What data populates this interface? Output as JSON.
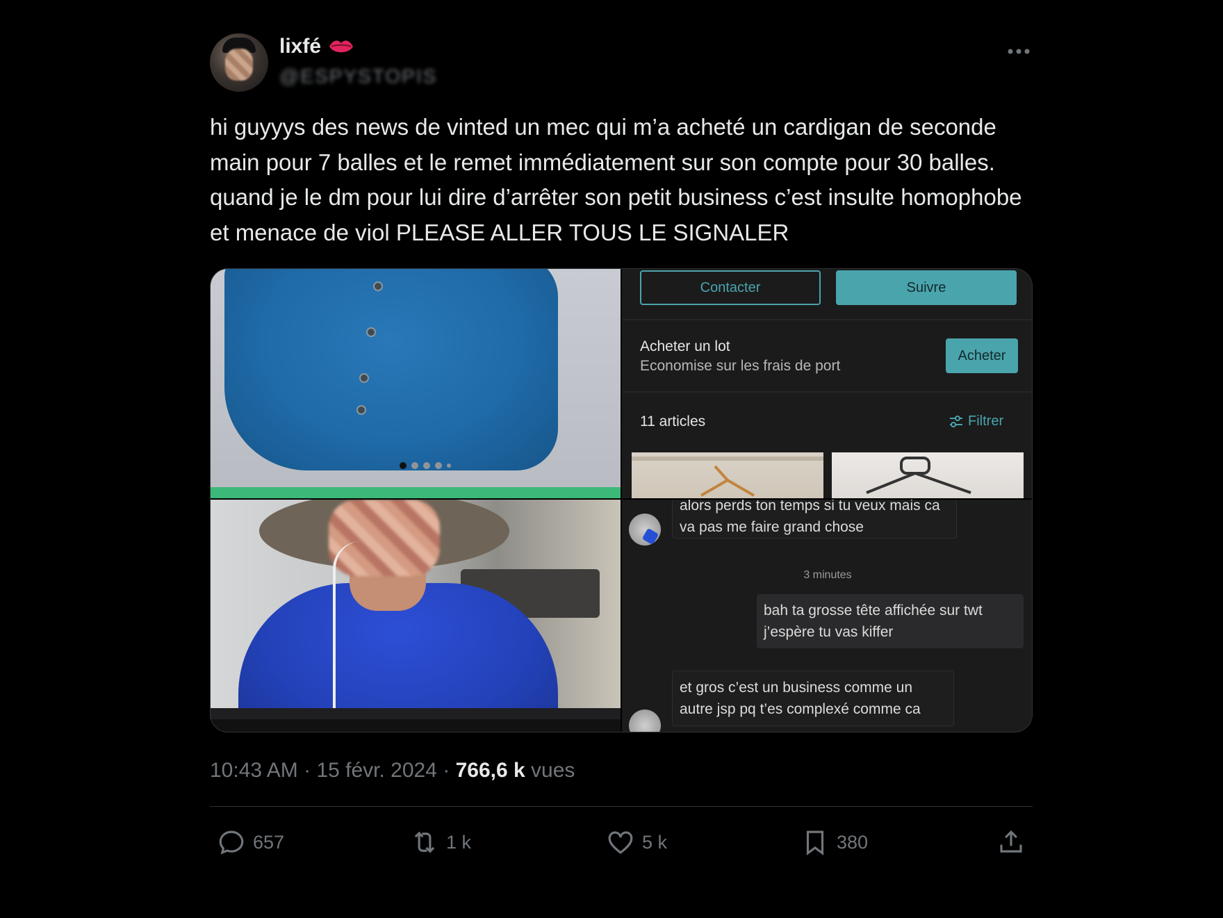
{
  "author": {
    "display_name": "lixfé",
    "handle": "@ESPYSTOPIS"
  },
  "tweet": {
    "text": "hi guyyys des news de vinted un mec qui m’a acheté un cardigan de seconde main pour 7 balles et le remet immédiatement sur son compte pour 30 balles. quand je le dm pour lui dire d’arrêter son petit business c’est insulte homophobe et menace de viol PLEASE ALLER TOUS LE SIGNALER",
    "time": "10:43 AM",
    "date": "15 févr. 2024",
    "views_count": "766,6 k",
    "views_label": "vues",
    "separator": " · "
  },
  "media": {
    "vinted": {
      "contact_label": "Contacter",
      "follow_label": "Suivre",
      "lot_title": "Acheter un lot",
      "lot_subtitle": "Economise sur les frais de port",
      "buy_label": "Acheter",
      "articles_count": "11 articles",
      "filter_label": "Filtrer"
    },
    "chat": {
      "message_1": "alors perds ton temps si tu veux mais ca va pas me faire grand chose",
      "time_label": "3 minutes",
      "message_2": "bah ta grosse tête affichée sur twt j’espère tu vas kiffer",
      "message_3": "et gros c’est un business comme un autre jsp pq t’es complexé comme ca"
    },
    "accent_color": "#4aa4ac"
  },
  "actions": {
    "reply_count": "657",
    "retweet_count": "1 k",
    "like_count": "5 k",
    "bookmark_count": "380"
  }
}
